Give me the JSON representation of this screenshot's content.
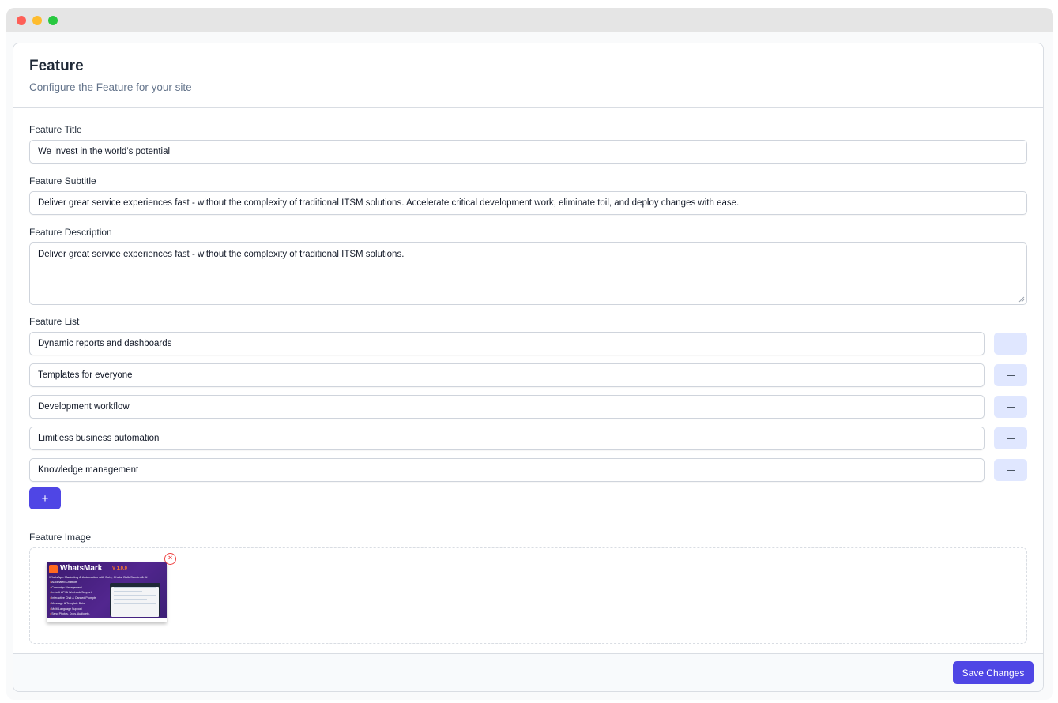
{
  "header": {
    "title": "Feature",
    "subtitle": "Configure the Feature for your site"
  },
  "fields": {
    "title_label": "Feature Title",
    "title_value": "We invest in the world’s potential",
    "subtitle_label": "Feature Subtitle",
    "subtitle_value": "Deliver great service experiences fast - without the complexity of traditional ITSM solutions. Accelerate critical development work, eliminate toil, and deploy changes with ease.",
    "description_label": "Feature Description",
    "description_value": "Deliver great service experiences fast - without the complexity of traditional ITSM solutions.",
    "list_label": "Feature List",
    "list_items": [
      "Dynamic reports and dashboards",
      "Templates for everyone",
      "Development workflow",
      "Limitless business automation",
      "Knowledge management"
    ],
    "remove_label": "−",
    "add_label": "+",
    "image_label": "Feature Image"
  },
  "image": {
    "title": "WhatsMark",
    "version": "V 1.0.0",
    "tagline": "WhatsApp Marketing & Automation with Bots, Chats, Bulk Sender & AI",
    "bullets": [
      "Automated Chatbots",
      "Campaign Management",
      "In-built API & Webhook Support",
      "Interactive Chat & Canned Prompts",
      "Message & Template Bots",
      "Multi-Language Support",
      "Send Photos, Docs, Audio etc."
    ],
    "remove_icon": "×"
  },
  "footer": {
    "save_label": "Save Changes"
  },
  "colors": {
    "accent": "#4f46e5",
    "minus_bg": "#e0e7ff",
    "danger": "#ef4444"
  }
}
